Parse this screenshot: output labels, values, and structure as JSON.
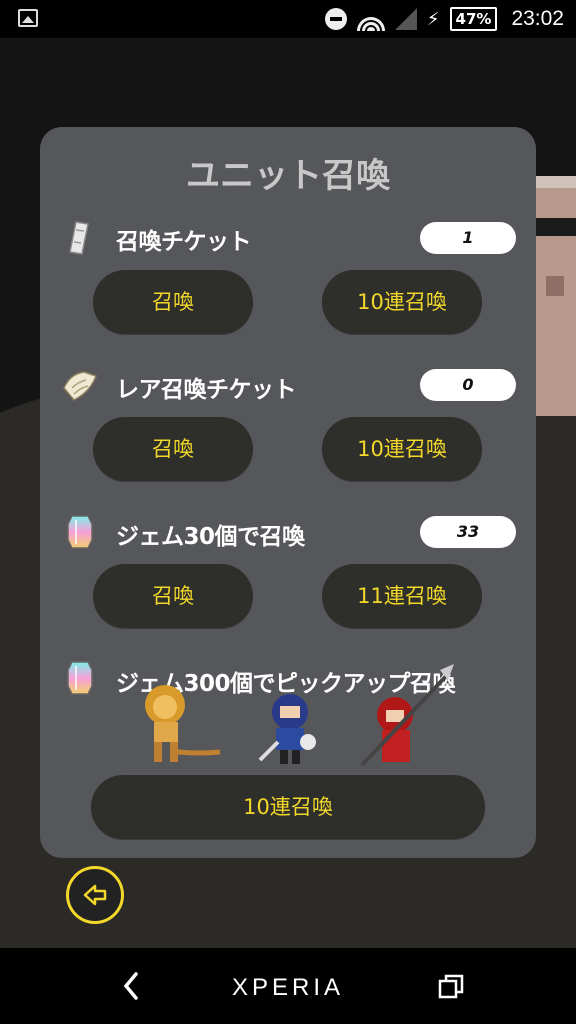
{
  "statusbar": {
    "battery": "47%",
    "time": "23:02"
  },
  "dialog": {
    "title": "ユニット召喚",
    "sections": [
      {
        "label": "召喚チケット",
        "count": "1",
        "btn1": "召喚",
        "btn2": "10連召喚"
      },
      {
        "label": "レア召喚チケット",
        "count": "0",
        "btn1": "召喚",
        "btn2": "10連召喚"
      },
      {
        "label": "ジェム30個で召喚",
        "count": "33",
        "btn1": "召喚",
        "btn2": "11連召喚"
      }
    ],
    "pickup": {
      "label": "ジェム300個でピックアップ召喚",
      "button": "10連召喚"
    }
  },
  "navbar": {
    "brand": "XPERIA"
  },
  "colors": {
    "accent": "#f2d82a",
    "panel": "#56575b",
    "button": "#2e2e2a"
  },
  "icons": [
    "ticket-icon",
    "rare-ticket-icon",
    "gem-icon",
    "back-arrow-icon"
  ]
}
